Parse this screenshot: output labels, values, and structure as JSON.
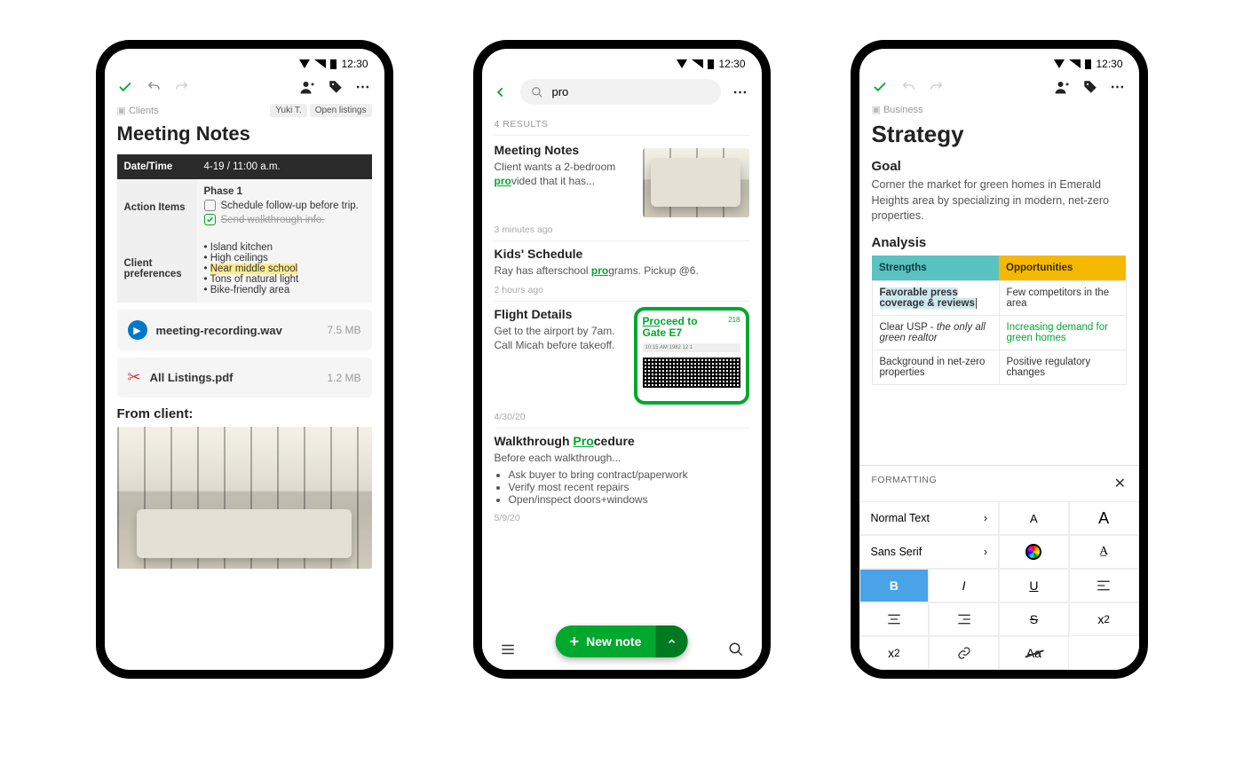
{
  "status": {
    "time": "12:30"
  },
  "phone1": {
    "crumb": "Clients",
    "tags": [
      "Yuki T.",
      "Open listings"
    ],
    "title": "Meeting Notes",
    "table": {
      "h_date": "Date/Time",
      "v_date": "4-19 / 11:00 a.m.",
      "h_action": "Action Items",
      "phase": "Phase 1",
      "todo1": "Schedule follow-up before trip.",
      "todo2": "Send walkthrough info.",
      "h_pref": "Client preferences",
      "prefs": [
        "Island kitchen",
        "High ceilings",
        "Near middle school",
        "Tons of natural light",
        "Bike-friendly area"
      ]
    },
    "attach1": {
      "name": "meeting-recording.wav",
      "size": "7.5 MB"
    },
    "attach2": {
      "name": "All Listings.pdf",
      "size": "1.2 MB"
    },
    "from_client": "From client:"
  },
  "phone2": {
    "search_value": "pro",
    "results_label": "4 RESULTS",
    "r1": {
      "title": "Meeting Notes",
      "pre": "Client wants a 2-bedroom ",
      "kw": "pro",
      "post": "vided that it has...",
      "when": "3 minutes ago"
    },
    "r2": {
      "title": "Kids' Schedule",
      "pre": "Ray has afterschool ",
      "kw": "pro",
      "post": "grams. Pickup @6.",
      "when": "2 hours ago"
    },
    "r3": {
      "title": "Flight Details",
      "body": "Get to the airport by 7am. Call Micah before takeoff.",
      "ticket_pre": "Pro",
      "ticket_post": "ceed to",
      "gate": "Gate E7",
      "ticket_num": "218",
      "times": "10:15 AM   1982   12   1",
      "when": "4/30/20"
    },
    "r4": {
      "title_pre": "Walkthrough ",
      "title_kw": "Pro",
      "title_post": "cedure",
      "lead": "Before each walkthrough...",
      "items": [
        "Ask buyer to bring contract/paperwork",
        "Verify most recent repairs",
        "Open/inspect doors+windows"
      ],
      "when": "5/9/20"
    },
    "fab": "New note"
  },
  "phone3": {
    "crumb": "Business",
    "title": "Strategy",
    "goal_h": "Goal",
    "goal": "Corner the market for green homes in Emerald Heights area by specializing in modern, net-zero properties.",
    "analysis_h": "Analysis",
    "s_h": "Strengths",
    "o_h": "Opportunities",
    "rows": [
      {
        "s": "Favorable press coverage & reviews",
        "o": "Few competitors in the area"
      },
      {
        "s_pre": "Clear USP - ",
        "s_em": "the only all green realtor",
        "o": "Increasing demand for green homes"
      },
      {
        "s": "Background in net-zero properties",
        "o": "Positive regulatory changes"
      }
    ],
    "panel": {
      "title": "FORMATTING",
      "style": "Normal Text",
      "font": "Sans Serif"
    }
  }
}
